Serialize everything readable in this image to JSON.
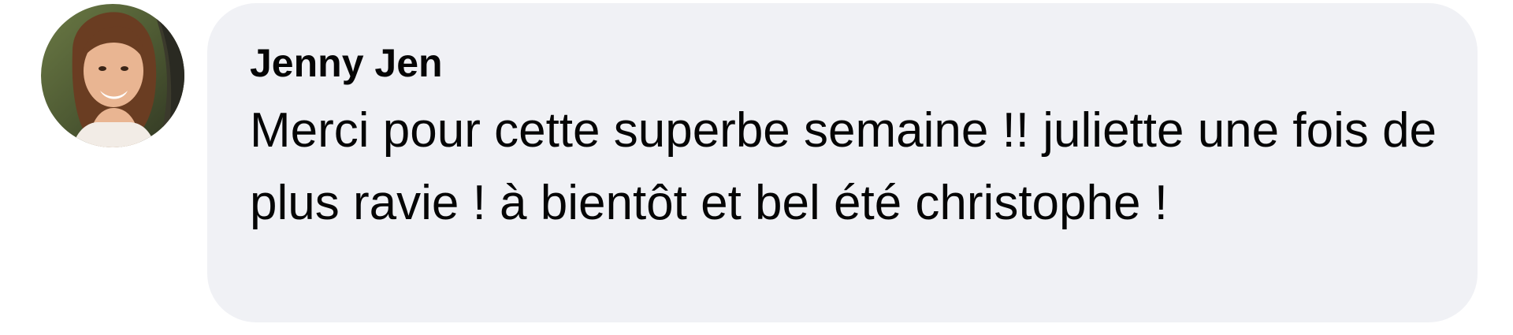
{
  "comment": {
    "author": "Jenny Jen",
    "avatar_icon": "profile-photo",
    "text": "Merci pour cette superbe semaine !! juliette une fois de plus ravie ! à bientôt et bel été christophe !"
  },
  "colors": {
    "bubble_background": "#f0f1f5",
    "text": "#050505"
  }
}
